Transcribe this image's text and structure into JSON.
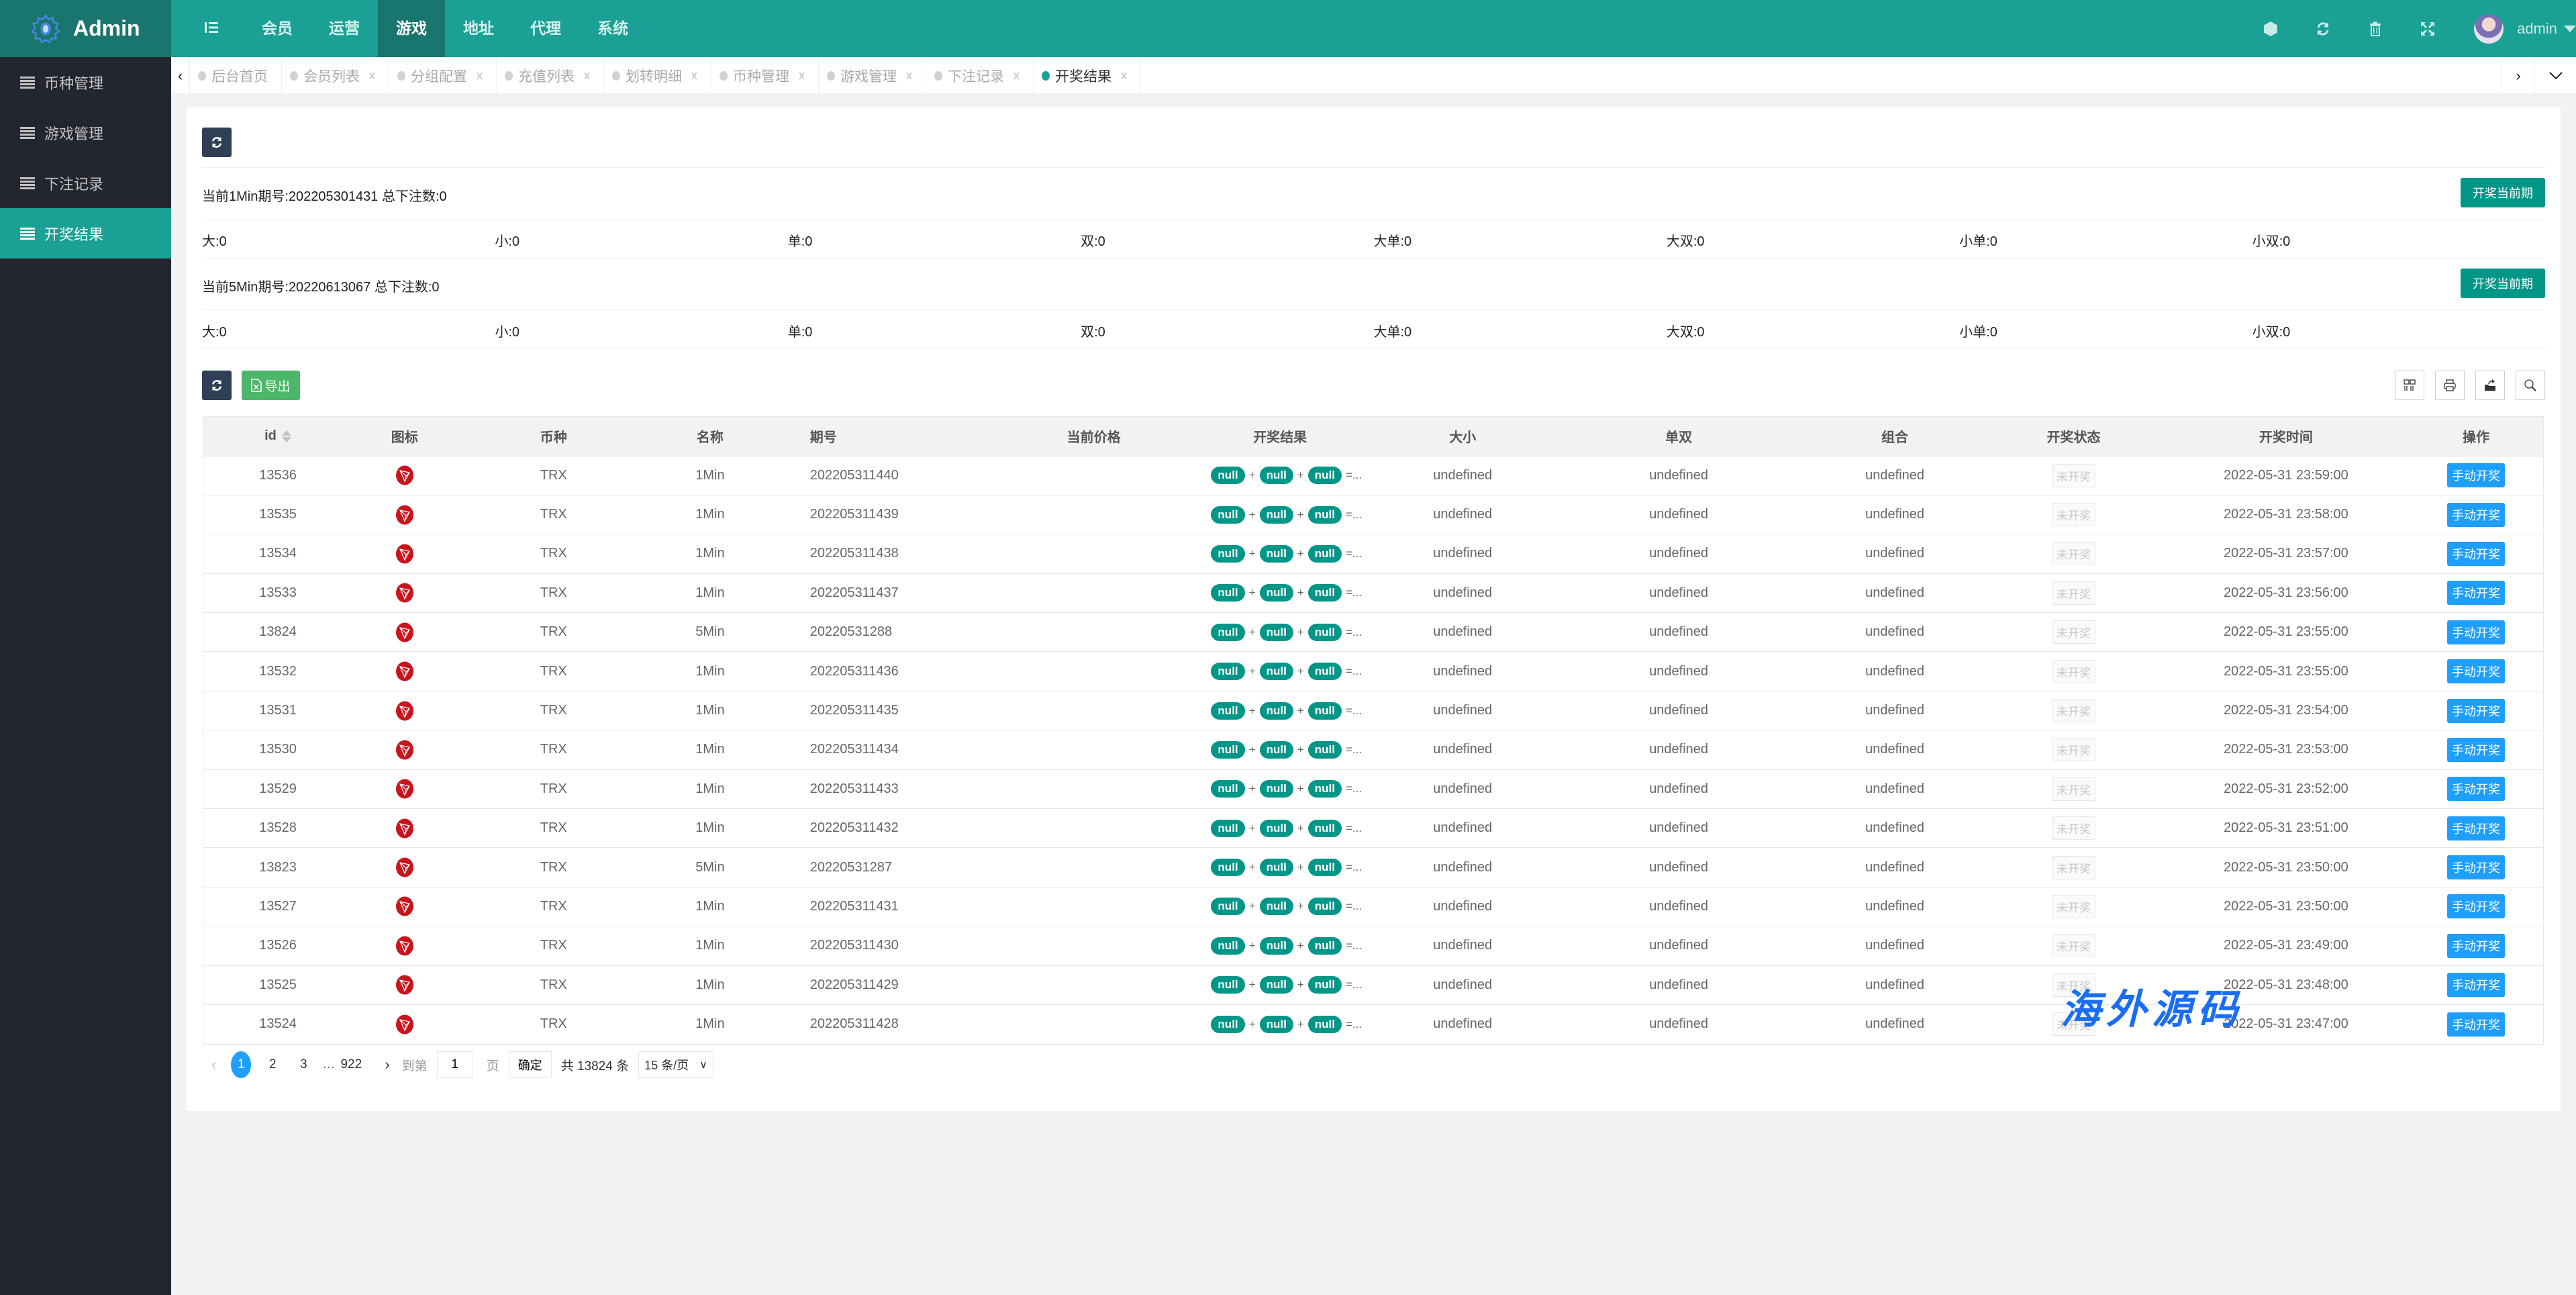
{
  "app": {
    "logo_text": "Admin",
    "user_name": "admin"
  },
  "top_nav": [
    {
      "label": "会员"
    },
    {
      "label": "运营"
    },
    {
      "label": "游戏",
      "active": true
    },
    {
      "label": "地址"
    },
    {
      "label": "代理"
    },
    {
      "label": "系统"
    }
  ],
  "top_tools": [
    "theme-icon",
    "refresh-icon",
    "clear-cache-icon",
    "fullscreen-icon"
  ],
  "sidebar": [
    {
      "label": "币种管理"
    },
    {
      "label": "游戏管理"
    },
    {
      "label": "下注记录"
    },
    {
      "label": "开奖结果",
      "active": true
    }
  ],
  "tabs": [
    {
      "label": "后台首页",
      "closable": false
    },
    {
      "label": "会员列表",
      "closable": true
    },
    {
      "label": "分组配置",
      "closable": true
    },
    {
      "label": "充值列表",
      "closable": true
    },
    {
      "label": "划转明细",
      "closable": true
    },
    {
      "label": "币种管理",
      "closable": true
    },
    {
      "label": "游戏管理",
      "closable": true
    },
    {
      "label": "下注记录",
      "closable": true
    },
    {
      "label": "开奖结果",
      "closable": true,
      "active": true
    }
  ],
  "tab_close_glyph": "x",
  "periods": [
    {
      "text": "当前1Min期号:202205301431 总下注数:0",
      "button": "开奖当前期",
      "stats": [
        "大:0",
        "小:0",
        "单:0",
        "双:0",
        "大单:0",
        "大双:0",
        "小单:0",
        "小双:0"
      ]
    },
    {
      "text": "当前5Min期号:20220613067 总下注数:0",
      "button": "开奖当前期",
      "stats": [
        "大:0",
        "小:0",
        "单:0",
        "双:0",
        "大单:0",
        "大双:0",
        "小单:0",
        "小双:0"
      ]
    }
  ],
  "toolbar": {
    "export_label": "导出"
  },
  "table": {
    "columns": [
      "id",
      "图标",
      "币种",
      "名称",
      "期号",
      "当前价格",
      "开奖结果",
      "大小",
      "单双",
      "组合",
      "开奖状态",
      "开奖时间",
      "操作"
    ],
    "result_pill": "null",
    "result_plus": "+",
    "result_tail": "=...",
    "status_label": "未开奖",
    "action_label": "手动开奖",
    "rows": [
      {
        "id": "13536",
        "coin": "TRX",
        "name": "1Min",
        "period": "202205311440",
        "price": "",
        "size": "undefined",
        "parity": "undefined",
        "combo": "undefined",
        "time": "2022-05-31 23:59:00"
      },
      {
        "id": "13535",
        "coin": "TRX",
        "name": "1Min",
        "period": "202205311439",
        "price": "",
        "size": "undefined",
        "parity": "undefined",
        "combo": "undefined",
        "time": "2022-05-31 23:58:00"
      },
      {
        "id": "13534",
        "coin": "TRX",
        "name": "1Min",
        "period": "202205311438",
        "price": "",
        "size": "undefined",
        "parity": "undefined",
        "combo": "undefined",
        "time": "2022-05-31 23:57:00"
      },
      {
        "id": "13533",
        "coin": "TRX",
        "name": "1Min",
        "period": "202205311437",
        "price": "",
        "size": "undefined",
        "parity": "undefined",
        "combo": "undefined",
        "time": "2022-05-31 23:56:00"
      },
      {
        "id": "13824",
        "coin": "TRX",
        "name": "5Min",
        "period": "20220531288",
        "price": "",
        "size": "undefined",
        "parity": "undefined",
        "combo": "undefined",
        "time": "2022-05-31 23:55:00"
      },
      {
        "id": "13532",
        "coin": "TRX",
        "name": "1Min",
        "period": "202205311436",
        "price": "",
        "size": "undefined",
        "parity": "undefined",
        "combo": "undefined",
        "time": "2022-05-31 23:55:00"
      },
      {
        "id": "13531",
        "coin": "TRX",
        "name": "1Min",
        "period": "202205311435",
        "price": "",
        "size": "undefined",
        "parity": "undefined",
        "combo": "undefined",
        "time": "2022-05-31 23:54:00"
      },
      {
        "id": "13530",
        "coin": "TRX",
        "name": "1Min",
        "period": "202205311434",
        "price": "",
        "size": "undefined",
        "parity": "undefined",
        "combo": "undefined",
        "time": "2022-05-31 23:53:00"
      },
      {
        "id": "13529",
        "coin": "TRX",
        "name": "1Min",
        "period": "202205311433",
        "price": "",
        "size": "undefined",
        "parity": "undefined",
        "combo": "undefined",
        "time": "2022-05-31 23:52:00"
      },
      {
        "id": "13528",
        "coin": "TRX",
        "name": "1Min",
        "period": "202205311432",
        "price": "",
        "size": "undefined",
        "parity": "undefined",
        "combo": "undefined",
        "time": "2022-05-31 23:51:00"
      },
      {
        "id": "13823",
        "coin": "TRX",
        "name": "5Min",
        "period": "20220531287",
        "price": "",
        "size": "undefined",
        "parity": "undefined",
        "combo": "undefined",
        "time": "2022-05-31 23:50:00"
      },
      {
        "id": "13527",
        "coin": "TRX",
        "name": "1Min",
        "period": "202205311431",
        "price": "",
        "size": "undefined",
        "parity": "undefined",
        "combo": "undefined",
        "time": "2022-05-31 23:50:00"
      },
      {
        "id": "13526",
        "coin": "TRX",
        "name": "1Min",
        "period": "202205311430",
        "price": "",
        "size": "undefined",
        "parity": "undefined",
        "combo": "undefined",
        "time": "2022-05-31 23:49:00"
      },
      {
        "id": "13525",
        "coin": "TRX",
        "name": "1Min",
        "period": "202205311429",
        "price": "",
        "size": "undefined",
        "parity": "undefined",
        "combo": "undefined",
        "time": "2022-05-31 23:48:00"
      },
      {
        "id": "13524",
        "coin": "TRX",
        "name": "1Min",
        "period": "202205311428",
        "price": "",
        "size": "undefined",
        "parity": "undefined",
        "combo": "undefined",
        "time": "2022-05-31 23:47:00"
      }
    ]
  },
  "pagination": {
    "pages": [
      "1",
      "2",
      "3"
    ],
    "current": "1",
    "ellipsis": "…",
    "last": "922",
    "goto_label": "到第",
    "goto_value": "1",
    "page_suffix": "页",
    "confirm_label": "确定",
    "total_label": "共 13824 条",
    "limit_label": "15 条/页"
  },
  "watermark": "海外源码",
  "colors": {
    "primary": "#1aa094",
    "dark_primary": "#19766e",
    "sidebar": "#23262e",
    "pill": "#009688",
    "action": "#1e9fff",
    "export": "#4cb66a"
  }
}
